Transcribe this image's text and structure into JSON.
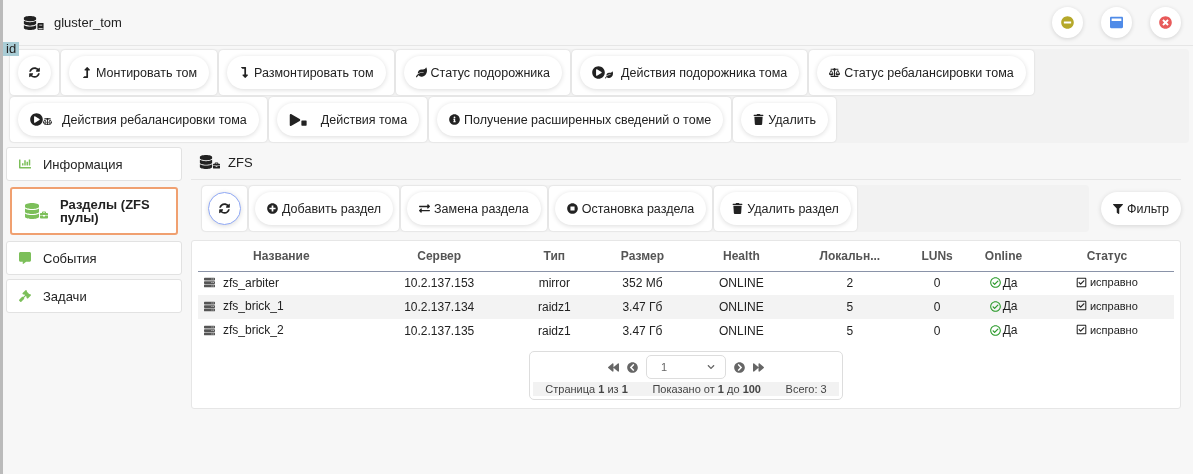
{
  "window": {
    "title": "gluster_tom",
    "tag": "id"
  },
  "actions": [
    {
      "kind": "refresh"
    },
    {
      "label": "Монтировать том"
    },
    {
      "label": "Размонтировать том"
    },
    {
      "label": "Статус подорожника"
    },
    {
      "label": "Действия подорожника тома"
    },
    {
      "label": "Статус ребалансировки тома"
    },
    {
      "label": "Действия ребалансировки тома"
    },
    {
      "label": "Действия тома"
    },
    {
      "label": "Получение расширенных сведений о томе"
    },
    {
      "label": "Удалить"
    }
  ],
  "sidebar": {
    "items": [
      {
        "label": "Информация",
        "selected": false
      },
      {
        "label": "Разделы (ZFS пулы)",
        "selected": true
      },
      {
        "label": "События",
        "selected": false
      },
      {
        "label": "Задачи",
        "selected": false
      }
    ]
  },
  "section": {
    "title": "ZFS"
  },
  "partition_actions": [
    {
      "kind": "refresh"
    },
    {
      "label": "Добавить раздел"
    },
    {
      "label": "Замена раздела"
    },
    {
      "label": "Остановка раздела"
    },
    {
      "label": "Удалить раздел"
    }
  ],
  "filter": {
    "label": "Фильтр"
  },
  "table": {
    "columns": [
      "Название",
      "Сервер",
      "Тип",
      "Размер",
      "Health",
      "Локальн...",
      "LUNs",
      "Online",
      "Статус"
    ],
    "rows": [
      {
        "cells": [
          "zfs_arbiter",
          "10.2.137.153",
          "mirror",
          "352 Мб",
          "ONLINE",
          "2",
          "0",
          "Да",
          "исправно"
        ]
      },
      {
        "cells": [
          "zfs_brick_1",
          "10.2.137.134",
          "raidz1",
          "3.47 Гб",
          "ONLINE",
          "5",
          "0",
          "Да",
          "исправно"
        ]
      },
      {
        "cells": [
          "zfs_brick_2",
          "10.2.137.135",
          "raidz1",
          "3.47 Гб",
          "ONLINE",
          "5",
          "0",
          "Да",
          "исправно"
        ]
      }
    ]
  },
  "pagination": {
    "page": "1",
    "page_info": "Страница **1** из **1**",
    "shown": "Показано от **1** до **100**",
    "total": "Всего: 3"
  }
}
